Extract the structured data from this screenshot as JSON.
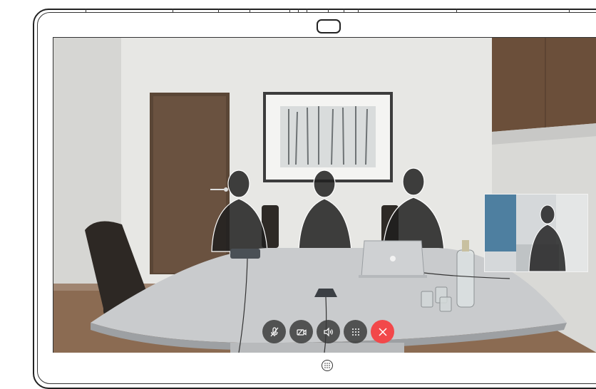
{
  "device": {
    "camera_icon": "camera-lens-icon",
    "home_icon": "home-grid-icon"
  },
  "call_controls": [
    {
      "name": "mute-button",
      "icon": "microphone-muted-icon"
    },
    {
      "name": "camera-button",
      "icon": "video-camera-icon"
    },
    {
      "name": "volume-button",
      "icon": "speaker-volume-icon"
    },
    {
      "name": "keypad-button",
      "icon": "keypad-grid-icon"
    },
    {
      "name": "end-call-button",
      "icon": "close-x-icon"
    }
  ],
  "colors": {
    "end_call": "#f2484a",
    "control_bg": "#373737",
    "wall": "#e6e6e4",
    "door": "#5a4636",
    "table": "#c9cbcd"
  }
}
